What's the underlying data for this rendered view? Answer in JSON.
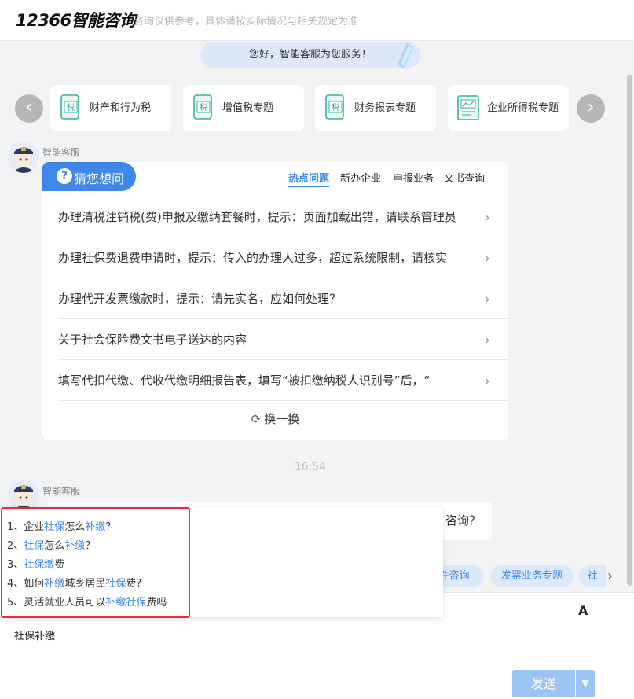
{
  "header": {
    "brand": "12366智能咨询",
    "subtitle": "咨询仅供参考，具体请按实际情况与相关规定为准"
  },
  "greeting": "您好，智能客服为您服务！",
  "topics": [
    {
      "label": "财产和行为税",
      "icon": "tax-doc-icon"
    },
    {
      "label": "增值税专题",
      "icon": "tax-doc-icon"
    },
    {
      "label": "财务报表专题",
      "icon": "tax-doc-icon"
    },
    {
      "label": "企业所得税专题",
      "icon": "report-chart-icon"
    }
  ],
  "bot_name": "智能客服",
  "guess": {
    "title": "猜您想问",
    "tabs": [
      {
        "label": "热点问题",
        "active": true
      },
      {
        "label": "新办企业",
        "active": false
      },
      {
        "label": "申报业务",
        "active": false
      },
      {
        "label": "文书查询",
        "active": false
      }
    ],
    "questions": [
      "办理清税注销税(费)申报及缴纳套餐时，提示：页面加载出错，请联系管理员",
      "办理社保费退费申请时，提示：传入的办理人过多，超过系统限制，请核实",
      "办理代开发票缴款时，提示：请先实名，应如何处理？",
      "关于社会保险费文书电子送达的内容",
      "填写代扣代缴、代收代缴明细报告表，填写“被扣缴纳税人识别号”后，“"
    ],
    "refresh_label": "换一换"
  },
  "time": "16:54",
  "second_bubble_tail": "咨询？",
  "chips": [
    "件咨询",
    "发票业务专题",
    "社"
  ],
  "suggestions": [
    {
      "num": "1、",
      "parts": [
        {
          "t": "企业",
          "h": false
        },
        {
          "t": "社保",
          "h": true
        },
        {
          "t": "怎么",
          "h": false
        },
        {
          "t": "补缴",
          "h": true
        },
        {
          "t": "？",
          "h": false
        }
      ]
    },
    {
      "num": "2、",
      "parts": [
        {
          "t": "社保",
          "h": true
        },
        {
          "t": "怎么",
          "h": false
        },
        {
          "t": "补缴",
          "h": true
        },
        {
          "t": "？",
          "h": false
        }
      ]
    },
    {
      "num": "3、",
      "parts": [
        {
          "t": "社保缴",
          "h": true
        },
        {
          "t": "费",
          "h": false
        }
      ]
    },
    {
      "num": "4、",
      "parts": [
        {
          "t": "如何",
          "h": false
        },
        {
          "t": "补缴",
          "h": true
        },
        {
          "t": "城乡居民",
          "h": false
        },
        {
          "t": "社保",
          "h": true
        },
        {
          "t": "费?",
          "h": false
        }
      ]
    },
    {
      "num": "5、",
      "parts": [
        {
          "t": "灵活就业人员可以",
          "h": false
        },
        {
          "t": "补缴",
          "h": true
        },
        {
          "t": "社保",
          "h": true
        },
        {
          "t": "费吗",
          "h": false
        }
      ]
    }
  ],
  "input": {
    "value": "社保补缴",
    "font_icon": "A",
    "send_label": "发送",
    "dropdown_icon": "▼"
  },
  "icons": {
    "prev": "‹",
    "next": "›",
    "chevron": "›",
    "chip_next": "›",
    "refresh": "⟳",
    "question": "?"
  },
  "colors": {
    "accent": "#3f87e8",
    "highlight_box": "#e5322f",
    "send_button": "#9cc4f5"
  }
}
